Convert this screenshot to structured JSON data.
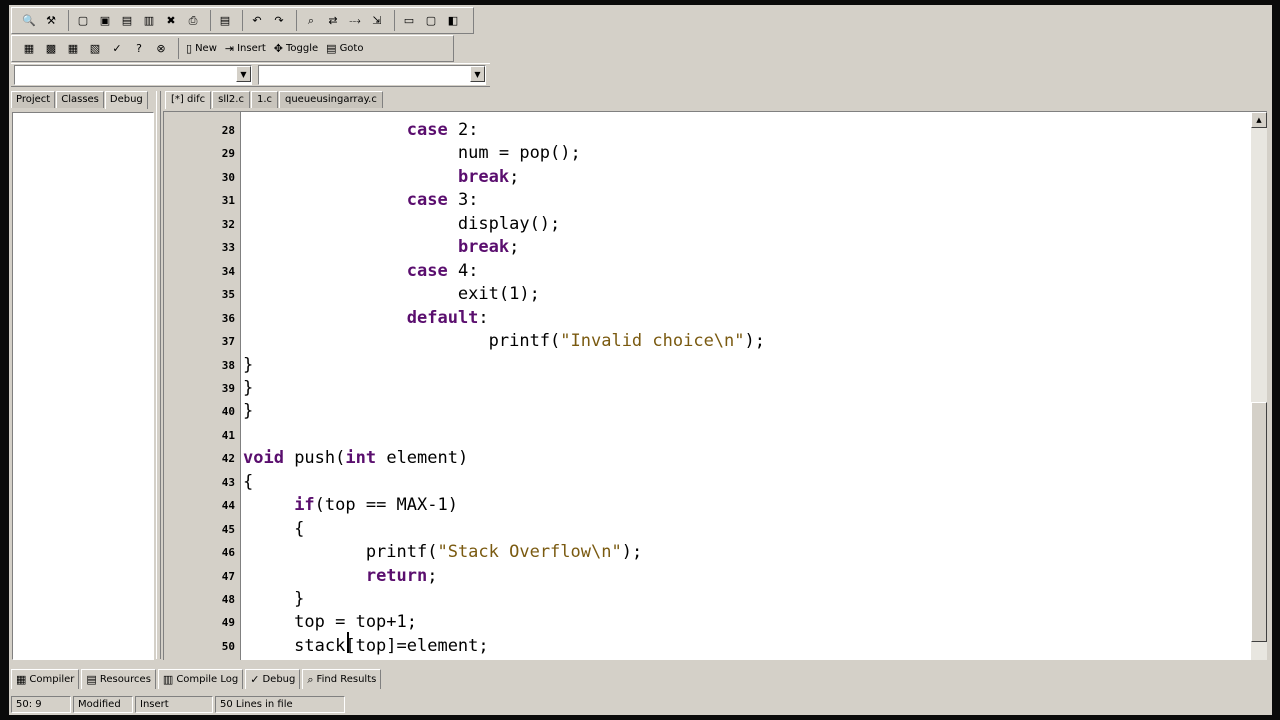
{
  "toolbar1": {
    "groups": [
      [
        "magnifier-icon",
        "wrench-icon"
      ],
      [
        "new-file-icon",
        "open-icon",
        "save-icon",
        "save-all-icon",
        "close-icon",
        "print-icon"
      ],
      [
        "print-preview-icon"
      ],
      [
        "undo-icon",
        "redo-icon"
      ],
      [
        "find-icon",
        "replace-icon",
        "find-next-icon",
        "goto-icon"
      ],
      [
        "compile-icon",
        "run-icon",
        "rebuild-icon"
      ]
    ]
  },
  "toolbar2": {
    "icons": [
      "project-view-icon",
      "class-view-icon",
      "grid-icon",
      "grid2-icon",
      "check-icon",
      "help-icon",
      "about-icon"
    ],
    "labels": {
      "new": "New",
      "insert": "Insert",
      "toggle": "Toggle",
      "goto": "Goto"
    }
  },
  "left_tabs": [
    "Project",
    "Classes",
    "Debug"
  ],
  "editor_tabs": [
    "[*] difc",
    "sll2.c",
    "1.c",
    "queueusingarray.c"
  ],
  "code_lines": [
    {
      "n": "28",
      "tokens": [
        {
          "t": "                ",
          "c": ""
        },
        {
          "t": "case",
          "c": "kw"
        },
        {
          "t": " 2:",
          "c": ""
        }
      ]
    },
    {
      "n": "29",
      "tokens": [
        {
          "t": "                     num = pop();",
          "c": ""
        }
      ]
    },
    {
      "n": "30",
      "tokens": [
        {
          "t": "                     ",
          "c": ""
        },
        {
          "t": "break",
          "c": "kw"
        },
        {
          "t": ";",
          "c": ""
        }
      ]
    },
    {
      "n": "31",
      "tokens": [
        {
          "t": "                ",
          "c": ""
        },
        {
          "t": "case",
          "c": "kw"
        },
        {
          "t": " 3:",
          "c": ""
        }
      ]
    },
    {
      "n": "32",
      "tokens": [
        {
          "t": "                     display();",
          "c": ""
        }
      ]
    },
    {
      "n": "33",
      "tokens": [
        {
          "t": "                     ",
          "c": ""
        },
        {
          "t": "break",
          "c": "kw"
        },
        {
          "t": ";",
          "c": ""
        }
      ]
    },
    {
      "n": "34",
      "tokens": [
        {
          "t": "                ",
          "c": ""
        },
        {
          "t": "case",
          "c": "kw"
        },
        {
          "t": " 4:",
          "c": ""
        }
      ]
    },
    {
      "n": "35",
      "tokens": [
        {
          "t": "                     exit(1);",
          "c": ""
        }
      ]
    },
    {
      "n": "36",
      "tokens": [
        {
          "t": "                ",
          "c": ""
        },
        {
          "t": "default",
          "c": "kw"
        },
        {
          "t": ":",
          "c": ""
        }
      ]
    },
    {
      "n": "37",
      "tokens": [
        {
          "t": "                        printf(",
          "c": ""
        },
        {
          "t": "\"Invalid choice\\n\"",
          "c": "str"
        },
        {
          "t": ");",
          "c": ""
        }
      ]
    },
    {
      "n": "38",
      "tokens": [
        {
          "t": "}",
          "c": ""
        }
      ]
    },
    {
      "n": "39",
      "tokens": [
        {
          "t": "}",
          "c": ""
        }
      ]
    },
    {
      "n": "40",
      "tokens": [
        {
          "t": "}",
          "c": ""
        }
      ]
    },
    {
      "n": "41",
      "tokens": [
        {
          "t": "",
          "c": ""
        }
      ]
    },
    {
      "n": "42",
      "tokens": [
        {
          "t": "void",
          "c": "kw"
        },
        {
          "t": " push(",
          "c": ""
        },
        {
          "t": "int",
          "c": "kw"
        },
        {
          "t": " element)",
          "c": ""
        }
      ]
    },
    {
      "n": "43",
      "tokens": [
        {
          "t": "{",
          "c": ""
        }
      ]
    },
    {
      "n": "44",
      "tokens": [
        {
          "t": "     ",
          "c": ""
        },
        {
          "t": "if",
          "c": "kw"
        },
        {
          "t": "(top == MAX-1)",
          "c": ""
        }
      ]
    },
    {
      "n": "45",
      "tokens": [
        {
          "t": "     {",
          "c": ""
        }
      ]
    },
    {
      "n": "46",
      "tokens": [
        {
          "t": "            printf(",
          "c": ""
        },
        {
          "t": "\"Stack Overflow\\n\"",
          "c": "str"
        },
        {
          "t": ");",
          "c": ""
        }
      ]
    },
    {
      "n": "47",
      "tokens": [
        {
          "t": "            ",
          "c": ""
        },
        {
          "t": "return",
          "c": "kw"
        },
        {
          "t": ";",
          "c": ""
        }
      ]
    },
    {
      "n": "48",
      "tokens": [
        {
          "t": "     }",
          "c": ""
        }
      ]
    },
    {
      "n": "49",
      "tokens": [
        {
          "t": "     top = top+1;",
          "c": ""
        }
      ]
    },
    {
      "n": "50",
      "tokens": [
        {
          "t": "     stack[top]=element;",
          "c": ""
        }
      ]
    }
  ],
  "bottom_tabs": [
    {
      "icon": "compiler-icon",
      "label": "Compiler"
    },
    {
      "icon": "resources-icon",
      "label": "Resources"
    },
    {
      "icon": "compile-log-icon",
      "label": "Compile Log"
    },
    {
      "icon": "debug-icon",
      "label": "Debug"
    },
    {
      "icon": "find-results-icon",
      "label": "Find Results"
    }
  ],
  "status": {
    "position": "50: 9",
    "modified": "Modified",
    "mode": "Insert",
    "lines": "50 Lines in file"
  },
  "colors": {
    "keyword": "#5a0e6e",
    "string": "#7a5a10",
    "chrome": "#d4d0c8"
  }
}
